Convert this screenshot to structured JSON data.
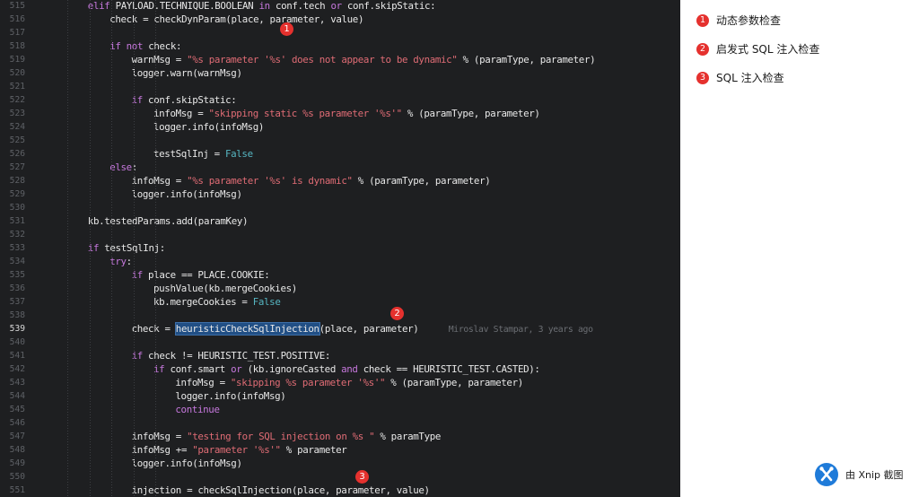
{
  "editor": {
    "lines": [
      {
        "n": "515",
        "indent": 2,
        "tokens": [
          [
            "k",
            "elif "
          ],
          [
            "",
            "PAYLOAD.TECHNIQUE.BOOLEAN "
          ],
          [
            "k",
            "in "
          ],
          [
            "",
            "conf.tech "
          ],
          [
            "k",
            "or "
          ],
          [
            "",
            "conf.skipStatic:"
          ]
        ]
      },
      {
        "n": "516",
        "indent": 3,
        "tokens": [
          [
            "",
            "check = checkDynParam(place, parameter, value)"
          ]
        ]
      },
      {
        "n": "517",
        "indent": 0,
        "tokens": []
      },
      {
        "n": "518",
        "indent": 3,
        "tokens": [
          [
            "k",
            "if not "
          ],
          [
            "",
            "check:"
          ]
        ]
      },
      {
        "n": "519",
        "indent": 4,
        "tokens": [
          [
            "",
            "warnMsg = "
          ],
          [
            "s",
            "\"%s parameter '%s' does not appear to be dynamic\""
          ],
          [
            "",
            " % (paramType, parameter)"
          ]
        ]
      },
      {
        "n": "520",
        "indent": 4,
        "tokens": [
          [
            "",
            "logger.warn(warnMsg)"
          ]
        ]
      },
      {
        "n": "521",
        "indent": 0,
        "tokens": []
      },
      {
        "n": "522",
        "indent": 4,
        "tokens": [
          [
            "k",
            "if "
          ],
          [
            "",
            "conf.skipStatic:"
          ]
        ]
      },
      {
        "n": "523",
        "indent": 5,
        "tokens": [
          [
            "",
            "infoMsg = "
          ],
          [
            "s",
            "\"skipping static %s parameter '%s'\""
          ],
          [
            "",
            " % (paramType, parameter)"
          ]
        ]
      },
      {
        "n": "524",
        "indent": 5,
        "tokens": [
          [
            "",
            "logger.info(infoMsg)"
          ]
        ]
      },
      {
        "n": "525",
        "indent": 0,
        "tokens": []
      },
      {
        "n": "526",
        "indent": 5,
        "tokens": [
          [
            "",
            "testSqlInj = "
          ],
          [
            "b",
            "False"
          ]
        ]
      },
      {
        "n": "527",
        "indent": 3,
        "tokens": [
          [
            "k",
            "else"
          ],
          [
            "",
            ":"
          ]
        ]
      },
      {
        "n": "528",
        "indent": 4,
        "tokens": [
          [
            "",
            "infoMsg = "
          ],
          [
            "s",
            "\"%s parameter '%s' is dynamic\""
          ],
          [
            "",
            " % (paramType, parameter)"
          ]
        ]
      },
      {
        "n": "529",
        "indent": 4,
        "tokens": [
          [
            "",
            "logger.info(infoMsg)"
          ]
        ]
      },
      {
        "n": "530",
        "indent": 0,
        "tokens": []
      },
      {
        "n": "531",
        "indent": 2,
        "tokens": [
          [
            "",
            "kb.testedParams.add(paramKey)"
          ]
        ]
      },
      {
        "n": "532",
        "indent": 0,
        "tokens": []
      },
      {
        "n": "533",
        "indent": 2,
        "tokens": [
          [
            "k",
            "if "
          ],
          [
            "",
            "testSqlInj:"
          ]
        ]
      },
      {
        "n": "534",
        "indent": 3,
        "tokens": [
          [
            "k",
            "try"
          ],
          [
            "",
            ":"
          ]
        ]
      },
      {
        "n": "535",
        "indent": 4,
        "tokens": [
          [
            "k",
            "if "
          ],
          [
            "",
            "place == PLACE.COOKIE:"
          ]
        ]
      },
      {
        "n": "536",
        "indent": 5,
        "tokens": [
          [
            "",
            "pushValue(kb.mergeCookies)"
          ]
        ]
      },
      {
        "n": "537",
        "indent": 5,
        "tokens": [
          [
            "",
            "kb.mergeCookies = "
          ],
          [
            "b",
            "False"
          ]
        ]
      },
      {
        "n": "538",
        "indent": 0,
        "tokens": []
      },
      {
        "n": "539",
        "indent": 4,
        "tokens": [
          [
            "",
            "check = "
          ],
          [
            "sel",
            "heuristicCheckSqlInjection"
          ],
          [
            "",
            "(place, parameter)"
          ],
          [
            "blame",
            "      Miroslav Stampar, 3 years ago"
          ]
        ]
      },
      {
        "n": "540",
        "indent": 0,
        "tokens": []
      },
      {
        "n": "541",
        "indent": 4,
        "tokens": [
          [
            "k",
            "if "
          ],
          [
            "",
            "check != HEURISTIC_TEST.POSITIVE:"
          ]
        ]
      },
      {
        "n": "542",
        "indent": 5,
        "tokens": [
          [
            "k",
            "if "
          ],
          [
            "",
            "conf.smart "
          ],
          [
            "k",
            "or "
          ],
          [
            "",
            "(kb.ignoreCasted "
          ],
          [
            "k",
            "and "
          ],
          [
            "",
            "check == HEURISTIC_TEST.CASTED):"
          ]
        ]
      },
      {
        "n": "543",
        "indent": 6,
        "tokens": [
          [
            "",
            "infoMsg = "
          ],
          [
            "s",
            "\"skipping %s parameter '%s'\""
          ],
          [
            "",
            " % (paramType, parameter)"
          ]
        ]
      },
      {
        "n": "544",
        "indent": 6,
        "tokens": [
          [
            "",
            "logger.info(infoMsg)"
          ]
        ]
      },
      {
        "n": "545",
        "indent": 6,
        "tokens": [
          [
            "k",
            "continue"
          ]
        ]
      },
      {
        "n": "546",
        "indent": 0,
        "tokens": []
      },
      {
        "n": "547",
        "indent": 4,
        "tokens": [
          [
            "",
            "infoMsg = "
          ],
          [
            "s",
            "\"testing for SQL injection on %s \""
          ],
          [
            "",
            " % paramType"
          ]
        ]
      },
      {
        "n": "548",
        "indent": 4,
        "tokens": [
          [
            "",
            "infoMsg += "
          ],
          [
            "s",
            "\"parameter '%s'\""
          ],
          [
            "",
            " % parameter"
          ]
        ]
      },
      {
        "n": "549",
        "indent": 4,
        "tokens": [
          [
            "",
            "logger.info(infoMsg)"
          ]
        ]
      },
      {
        "n": "550",
        "indent": 0,
        "tokens": []
      },
      {
        "n": "551",
        "indent": 4,
        "tokens": [
          [
            "",
            "injection = checkSqlInjection(place, parameter, value)"
          ]
        ]
      }
    ],
    "active_line": "539",
    "markers": [
      "1",
      "2",
      "3"
    ]
  },
  "legend": {
    "items": [
      {
        "num": "1",
        "text": "动态参数检查"
      },
      {
        "num": "2",
        "text": "启发式 SQL 注入检查"
      },
      {
        "num": "3",
        "text": "SQL 注入检查"
      }
    ]
  },
  "watermark": {
    "text": "由 Xnip 截图"
  },
  "colors": {
    "editor_bg": "#1e1f21",
    "keyword": "#c678dd",
    "builtin": "#56b6c2",
    "string": "#e06c75",
    "badge": "#e5312e",
    "selection": "#214f85"
  }
}
